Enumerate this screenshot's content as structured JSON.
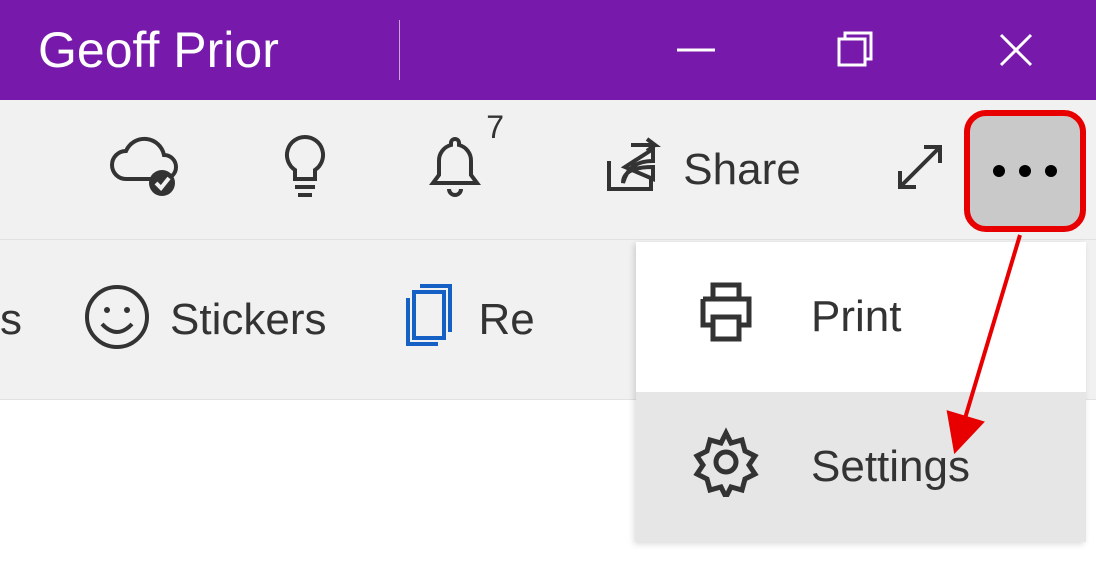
{
  "titlebar": {
    "title": "Geoff Prior"
  },
  "toolbar1": {
    "notification_count": "7",
    "share_label": "Share"
  },
  "toolbar2": {
    "left_fragment": "s",
    "stickers_label": "Stickers",
    "re_fragment": "Re"
  },
  "dropdown": {
    "print_label": "Print",
    "settings_label": "Settings"
  }
}
